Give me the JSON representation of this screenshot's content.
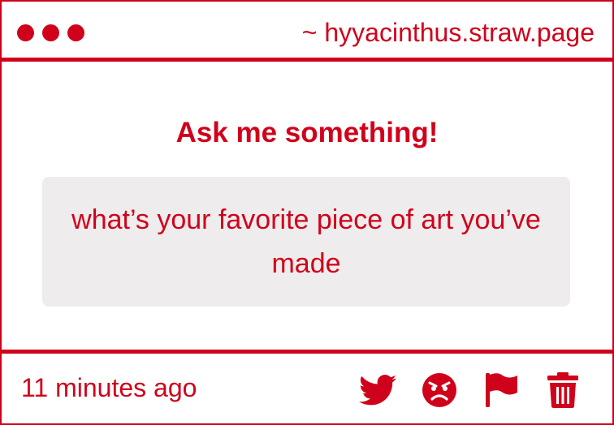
{
  "window": {
    "url": "~ hyyacinthus.straw.page",
    "dots": [
      "dot-1",
      "dot-2",
      "dot-3"
    ]
  },
  "card": {
    "heading": "Ask me something!",
    "question": "what’s your favorite piece of art you’ve made"
  },
  "footer": {
    "timestamp": "11 minutes ago",
    "actions": [
      {
        "name": "share-twitter-button",
        "icon": "twitter-icon"
      },
      {
        "name": "react-angry-button",
        "icon": "angry-face-icon"
      },
      {
        "name": "report-button",
        "icon": "flag-icon"
      },
      {
        "name": "delete-button",
        "icon": "trash-icon"
      }
    ]
  },
  "colors": {
    "accent": "#d0021b",
    "question_bg": "#eeecec",
    "background": "#ffffff"
  }
}
